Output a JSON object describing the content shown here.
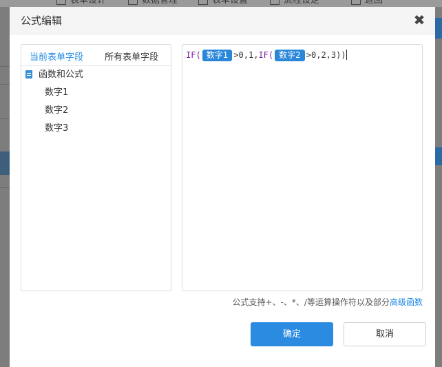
{
  "background": {
    "tabs": [
      {
        "label": "表单设计"
      },
      {
        "label": "数据管理"
      },
      {
        "label": "表单设置"
      },
      {
        "label": "流程设定"
      },
      {
        "label": "返回"
      }
    ]
  },
  "dialog": {
    "title": "公式编辑",
    "close_icon": "close-icon",
    "fields": {
      "tabs": [
        "当前表单字段",
        "所有表单字段"
      ],
      "active_tab": 0,
      "group_label": "函数和公式",
      "items": [
        "数字1",
        "数字2",
        "数字3"
      ]
    },
    "formula": {
      "parts": [
        {
          "type": "kw",
          "text": "IF("
        },
        {
          "type": "chip",
          "text": "数字1"
        },
        {
          "type": "tx",
          "text": ">0,1,"
        },
        {
          "type": "kw",
          "text": "IF("
        },
        {
          "type": "chip",
          "text": "数字2"
        },
        {
          "type": "tx",
          "text": ">0,2,3))"
        }
      ]
    },
    "hint": {
      "text": "公式支持+、-、*、/等运算操作符以及部分",
      "link": "高级函数"
    },
    "buttons": {
      "ok": "确定",
      "cancel": "取消"
    }
  },
  "colors": {
    "accent": "#2a8be0",
    "chip": "#2a86d8",
    "keyword": "#7a1fa2",
    "link": "#1e88e5"
  }
}
